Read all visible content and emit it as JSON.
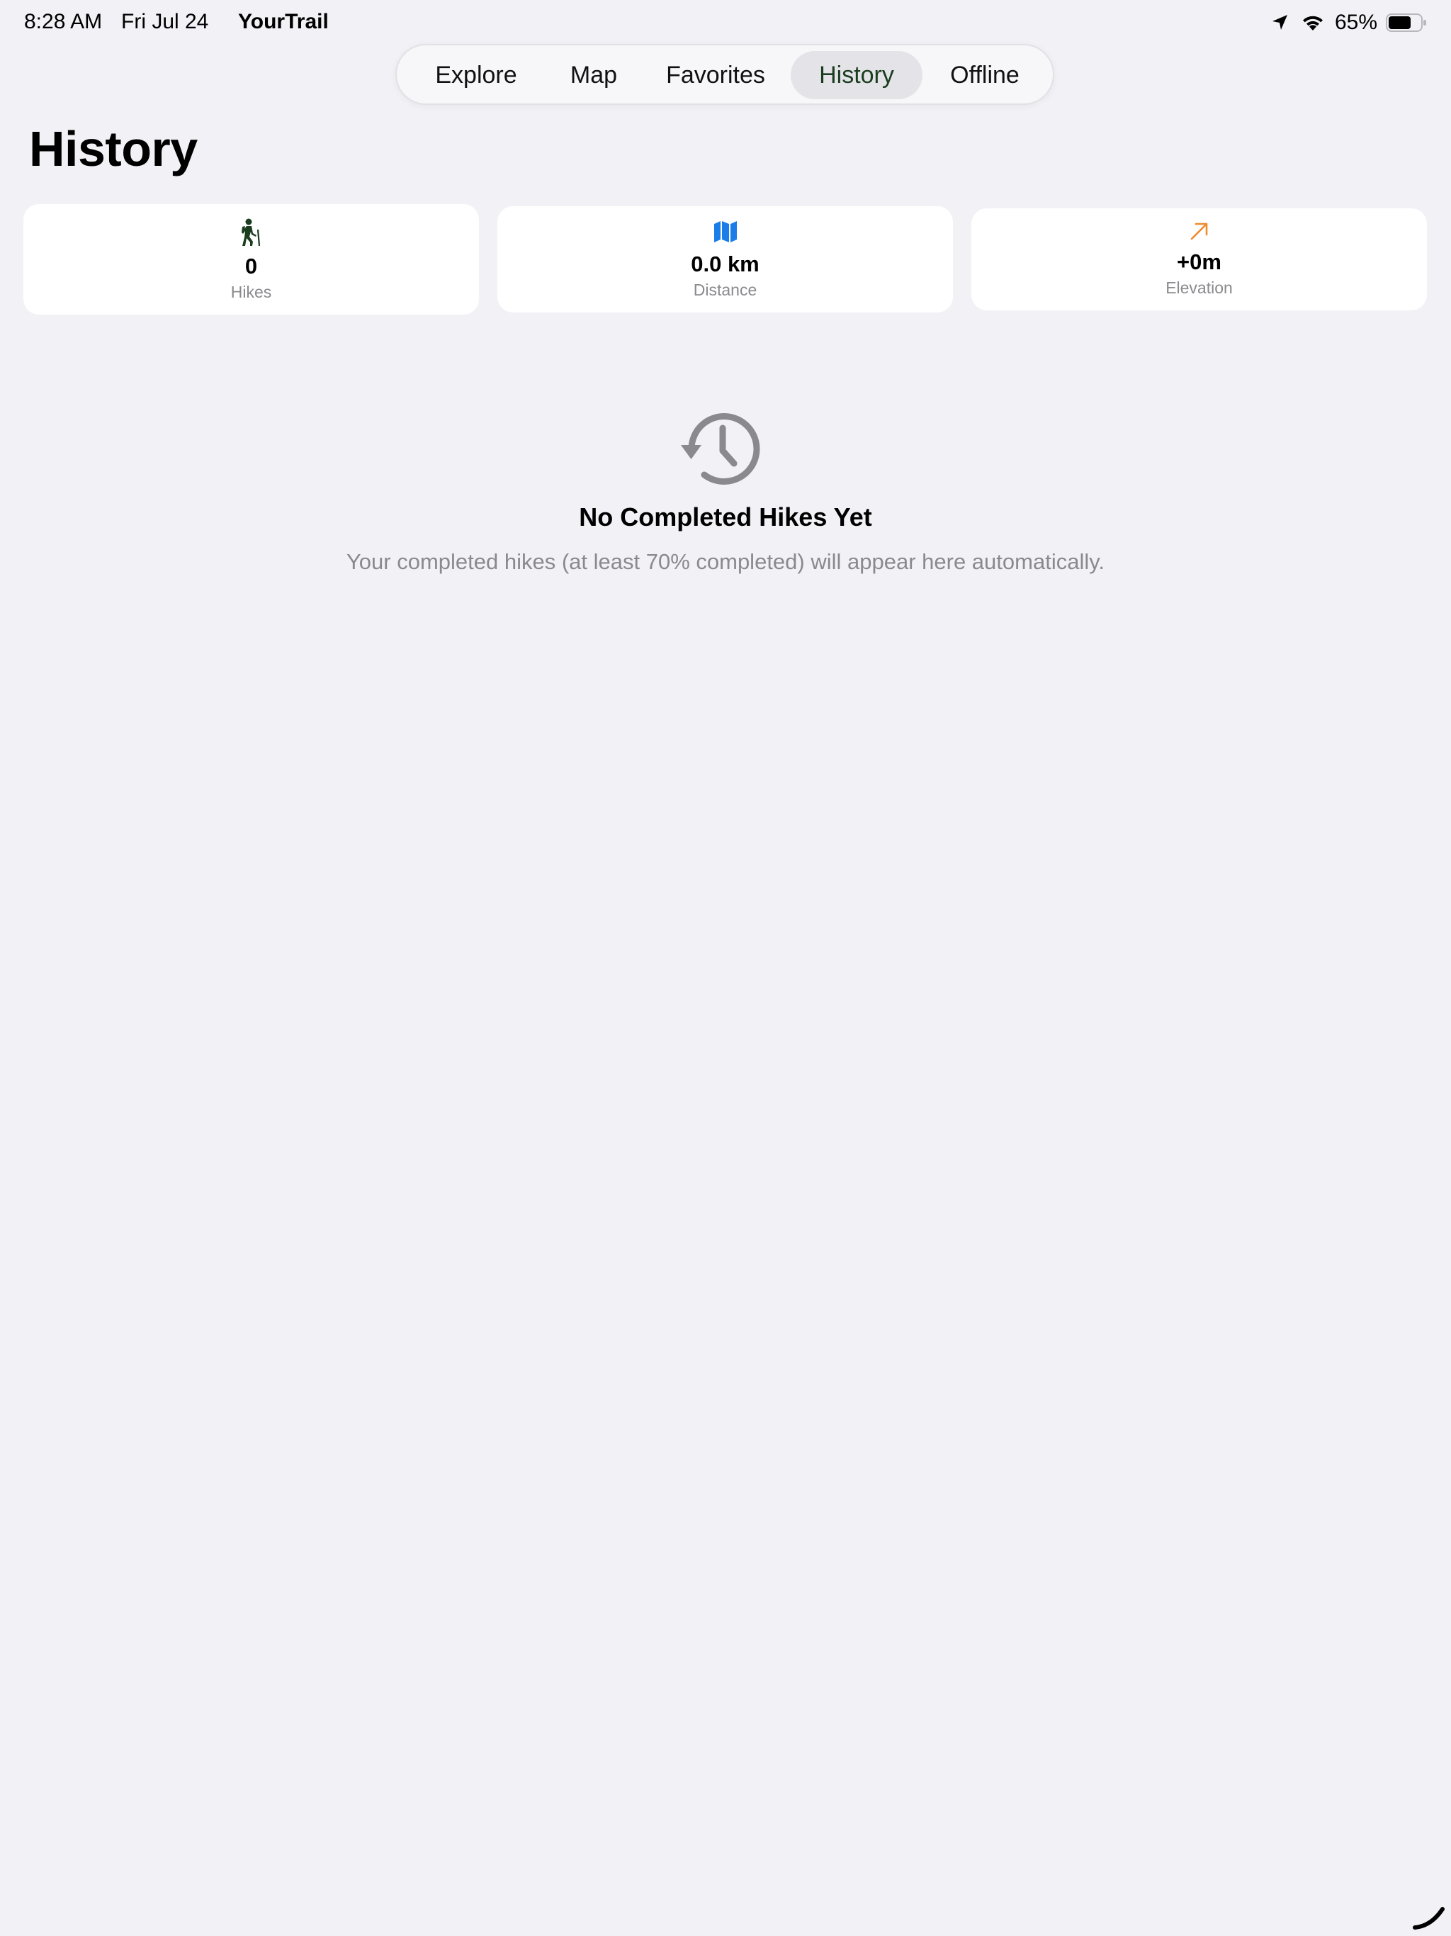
{
  "status_bar": {
    "time": "8:28 AM",
    "date": "Fri Jul 24",
    "app_name": "YourTrail",
    "battery": "65%"
  },
  "tabs": [
    {
      "label": "Explore",
      "active": false
    },
    {
      "label": "Map",
      "active": false
    },
    {
      "label": "Favorites",
      "active": false
    },
    {
      "label": "History",
      "active": true
    },
    {
      "label": "Offline",
      "active": false
    }
  ],
  "page": {
    "title": "History"
  },
  "stats": [
    {
      "icon": "hiker-icon",
      "value": "0",
      "label": "Hikes",
      "color": "#1b3d1f"
    },
    {
      "icon": "map-icon",
      "value": "0.0 km",
      "label": "Distance",
      "color": "#1a7de8"
    },
    {
      "icon": "arrow-up-right-icon",
      "value": "+0m",
      "label": "Elevation",
      "color": "#f08a2c"
    }
  ],
  "empty_state": {
    "icon": "history-clock-icon",
    "title": "No Completed Hikes Yet",
    "subtitle": "Your completed hikes (at least 70% completed) will appear here automatically."
  },
  "colors": {
    "background": "#f1f1f6",
    "card": "#ffffff",
    "accent_green": "#1b3d1f",
    "secondary_text": "#8a8a8e"
  }
}
